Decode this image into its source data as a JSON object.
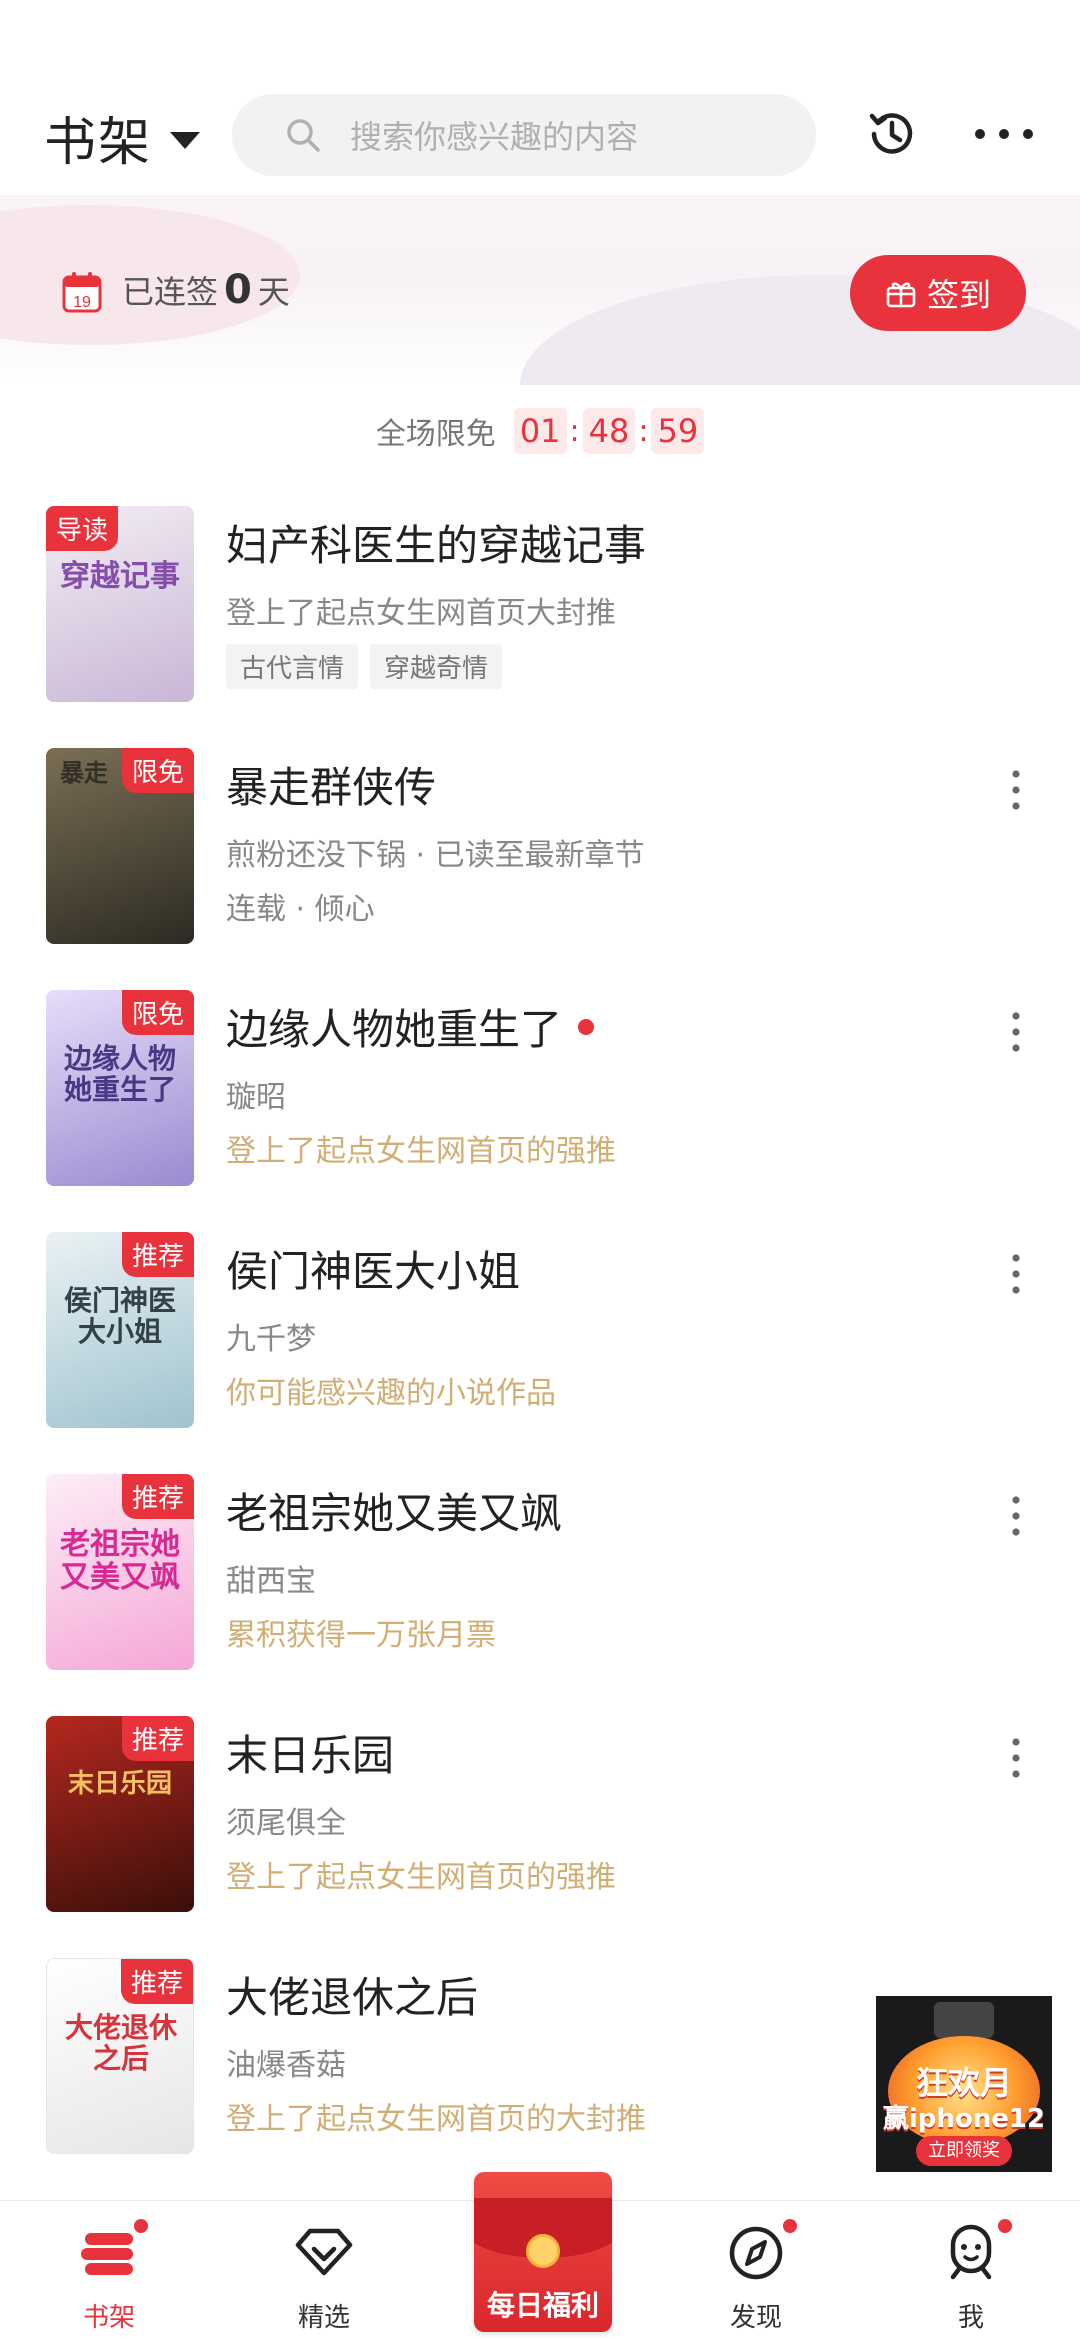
{
  "header": {
    "shelf_label": "书架",
    "search_placeholder": "搜索你感兴趣的内容"
  },
  "checkin": {
    "calendar_day": "19",
    "streak_prefix": "已连签",
    "streak_count": "0",
    "streak_suffix": "天",
    "button_label": "签到"
  },
  "free_promo": {
    "label": "全场限免",
    "hours": "01",
    "minutes": "48",
    "seconds": "59",
    "separator": ":"
  },
  "books": [
    {
      "title": "妇产科医生的穿越记事",
      "badge": "导读",
      "subtitle": "登上了起点女生网首页大封推",
      "tags": [
        "古代言情",
        "穿越奇情"
      ],
      "cover_colors": [
        "#f3eef3",
        "#c9b6d6"
      ],
      "cover_text": "穿越记事",
      "unread": false
    },
    {
      "title": "暴走群侠传",
      "badge": "限免",
      "subtitle": "煎粉还没下锅 · 已读至最新章节",
      "note": "连载 · 倾心",
      "cover_colors": [
        "#7b6f55",
        "#2c2a22"
      ],
      "cover_text": "暴走",
      "unread": false
    },
    {
      "title": "边缘人物她重生了",
      "badge": "限免",
      "subtitle": "璇昭",
      "note": "登上了起点女生网首页的强推",
      "cover_colors": [
        "#e6defa",
        "#9b8ad0"
      ],
      "cover_text": "边缘人物她重生了",
      "unread": true
    },
    {
      "title": "侯门神医大小姐",
      "badge": "推荐",
      "subtitle": "九千梦",
      "note": "你可能感兴趣的小说作品",
      "cover_colors": [
        "#eaf2f4",
        "#9fc3cf"
      ],
      "cover_text": "侯门神医大小姐",
      "unread": false
    },
    {
      "title": "老祖宗她又美又飒",
      "badge": "推荐",
      "subtitle": "甜西宝",
      "note": "累积获得一万张月票",
      "cover_colors": [
        "#fdeef7",
        "#f5a7d6"
      ],
      "cover_text": "老祖宗她又美又飒",
      "unread": false
    },
    {
      "title": "末日乐园",
      "badge": "推荐",
      "subtitle": "须尾俱全",
      "note": "登上了起点女生网首页的强推",
      "cover_colors": [
        "#b5281f",
        "#3a0f0a"
      ],
      "cover_text": "末日乐园",
      "unread": false
    },
    {
      "title": "大佬退休之后",
      "badge": "推荐",
      "subtitle": "油爆香菇",
      "note": "登上了起点女生网首页的大封推",
      "cover_colors": [
        "#ffffff",
        "#e6e6e6"
      ],
      "cover_text": "大佬退休之后",
      "unread": false
    }
  ],
  "float_ad": {
    "line1": "狂欢月",
    "line2": "赢iphone12",
    "cta": "立即领奖"
  },
  "bottom_nav": {
    "items": [
      {
        "label": "书架",
        "active": true,
        "dot": true
      },
      {
        "label": "精选",
        "active": false,
        "dot": false
      },
      {
        "label": "发现",
        "active": false,
        "dot": true
      },
      {
        "label": "我",
        "active": false,
        "dot": true
      }
    ],
    "welfare_label": "每日福利"
  },
  "colors": {
    "accent": "#e8333d",
    "note_gold": "#d1ae74",
    "text_gray": "#888888"
  }
}
